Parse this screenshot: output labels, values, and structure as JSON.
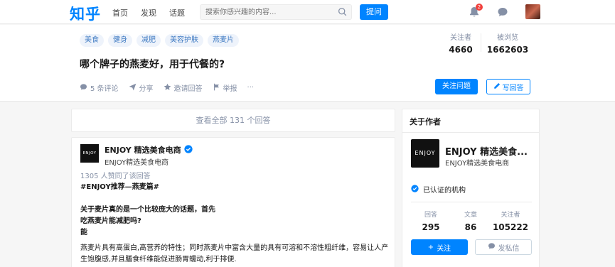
{
  "nav": {
    "logo": "知乎",
    "items": [
      "首页",
      "发现",
      "话题"
    ],
    "search_placeholder": "搜索你感兴趣的内容...",
    "ask_label": "提问",
    "notification_count": "2"
  },
  "question": {
    "tags": [
      "美食",
      "健身",
      "减肥",
      "美容护肤",
      "燕麦片"
    ],
    "title": "哪个牌子的燕麦好，用于代餐的?",
    "actions": {
      "comments": "5 条评论",
      "share": "分享",
      "invite": "邀请回答",
      "report": "举报",
      "more": "···"
    },
    "stats": {
      "followers_label": "关注者",
      "followers_value": "4660",
      "views_label": "被浏览",
      "views_value": "1662603"
    },
    "follow_label": "关注问题",
    "write_label": "写回答"
  },
  "answers": {
    "view_all": "查看全部 131 个回答"
  },
  "answer": {
    "logo_text": "ENJOY",
    "author_name": "ENJOY 精选美食电商",
    "author_sub": "ENJOY精选美食电商",
    "likes": "1305 人赞同了该回答",
    "body": [
      "#ENJOY推荐—燕麦篇#",
      "",
      "关于麦片真的是一个比较庞大的话题，首先",
      "吃燕麦片能减肥吗?",
      "能",
      "燕麦片具有高蛋白,高营养的特性；同时燕麦片中富含大量的具有可溶和不溶性粗纤维，容易让人产",
      "生饱腹感,并且膳食纤维能促进肠胃蠕动,利于排便."
    ]
  },
  "about": {
    "title": "关于作者",
    "logo_text": "ENJOY",
    "name": "ENJOY 精选美食...",
    "sub": "ENJOY精选美食电商",
    "verified": "已认证的机构",
    "stats": [
      {
        "label": "回答",
        "value": "295"
      },
      {
        "label": "文章",
        "value": "86"
      },
      {
        "label": "关注者",
        "value": "105222"
      }
    ],
    "follow_label": "关注",
    "pm_label": "发私信"
  },
  "colors": {
    "accent": "#0084ff",
    "tag_bg": "#eef3fb",
    "tag_text": "#3e7ac2",
    "badge": "#f1403c"
  }
}
